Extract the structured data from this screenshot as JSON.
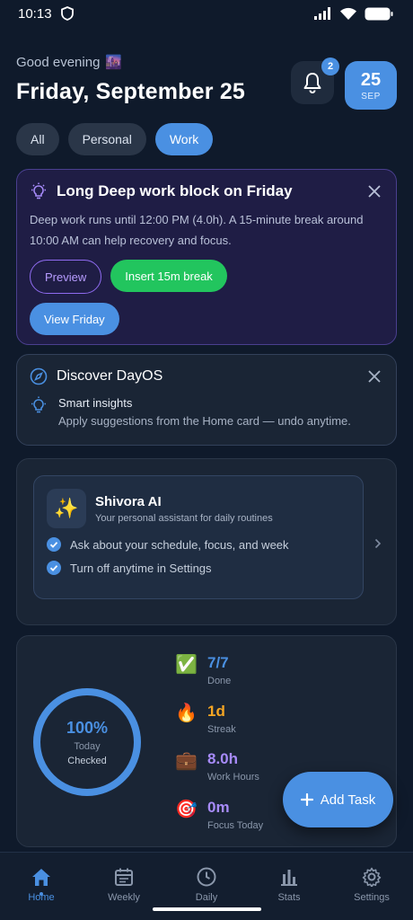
{
  "status": {
    "time": "10:13"
  },
  "header": {
    "greeting": "Good evening",
    "greeting_emoji": "🌆",
    "date_title": "Friday, September 25",
    "notification_count": "2",
    "date_chip_day": "25",
    "date_chip_month": "SEP"
  },
  "filters": [
    {
      "label": "All",
      "active": false
    },
    {
      "label": "Personal",
      "active": false
    },
    {
      "label": "Work",
      "active": true
    }
  ],
  "insight_card": {
    "title": "Long Deep work block on Friday",
    "body": "Deep work runs until 12:00 PM (4.0h). A 15-minute break around 10:00 AM can help recovery and focus.",
    "preview_label": "Preview",
    "insert_label": "Insert 15m break",
    "view_label": "View Friday"
  },
  "discover_card": {
    "title": "Discover DayOS",
    "sub_title": "Smart insights",
    "sub_body": "Apply suggestions from the Home card — undo anytime."
  },
  "ai_card": {
    "icon_emoji": "✨",
    "name": "Shivora AI",
    "tagline": "Your personal assistant for daily routines",
    "points": [
      "Ask about your schedule, focus, and week",
      "Turn off anytime in Settings"
    ]
  },
  "progress": {
    "percent_label": "100%",
    "percent_value": 1.0,
    "line1": "Today",
    "line2": "Checked"
  },
  "stats": [
    {
      "emoji": "✅",
      "value": "7/7",
      "label": "Done",
      "color": "#4a90e2"
    },
    {
      "emoji": "🔥",
      "value": "1d",
      "label": "Streak",
      "color": "#f5a623"
    },
    {
      "emoji": "💼",
      "value": "8.0h",
      "label": "Work Hours",
      "color": "#a78bfa"
    },
    {
      "emoji": "🎯",
      "value": "0m",
      "label": "Focus Today",
      "color": "#a78bfa"
    }
  ],
  "fab": {
    "label": "Add Task"
  },
  "tabs": [
    {
      "label": "Home",
      "icon": "home-icon",
      "active": true
    },
    {
      "label": "Weekly",
      "icon": "calendar-icon",
      "active": false
    },
    {
      "label": "Daily",
      "icon": "clock-icon",
      "active": false
    },
    {
      "label": "Stats",
      "icon": "bar-chart-icon",
      "active": false
    },
    {
      "label": "Settings",
      "icon": "gear-icon",
      "active": false
    }
  ],
  "colors": {
    "accent": "#4a90e2",
    "success": "#22c55e",
    "purple": "#8f6bf0"
  }
}
